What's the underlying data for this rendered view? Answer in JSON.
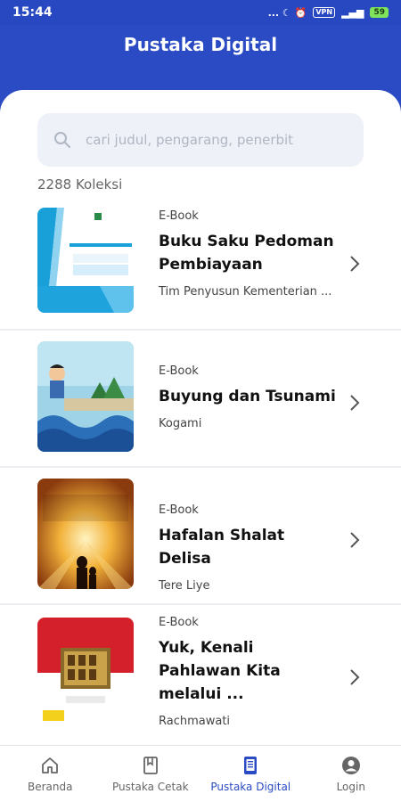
{
  "status_bar": {
    "time": "15:44",
    "indicators": "... ☾ ⏰",
    "vpn": "VPN",
    "battery": "59"
  },
  "app_bar": {
    "title": "Pustaka Digital"
  },
  "search": {
    "placeholder": "cari judul, pengarang, penerbit",
    "value": ""
  },
  "collection_count": "2288 Koleksi",
  "books": [
    {
      "type": "E-Book",
      "title": "Buku Saku Pedoman Pembiayaan",
      "author": "Tim Penyusun Kementerian ...",
      "cover_icon": "cover-blue-white"
    },
    {
      "type": "E-Book",
      "title": "Buyung dan Tsunami",
      "author": "Kogami",
      "cover_icon": "cover-illustrated"
    },
    {
      "type": "E-Book",
      "title": "Hafalan Shalat Delisa",
      "author": "Tere Liye",
      "cover_icon": "cover-sunset"
    },
    {
      "type": "E-Book",
      "title": "Yuk, Kenali Pahlawan Kita melalui ...",
      "author": "Rachmawati",
      "cover_icon": "cover-red-white"
    }
  ],
  "bottom_nav": [
    {
      "label": "Beranda",
      "icon": "home-icon",
      "active": false
    },
    {
      "label": "Pustaka Cetak",
      "icon": "book-icon",
      "active": false
    },
    {
      "label": "Pustaka Digital",
      "icon": "tablet-icon",
      "active": true
    },
    {
      "label": "Login",
      "icon": "account-icon",
      "active": false
    }
  ],
  "colors": {
    "primary": "#2b4bc4",
    "background": "#ffffff",
    "search_bg": "#eef1f8"
  }
}
